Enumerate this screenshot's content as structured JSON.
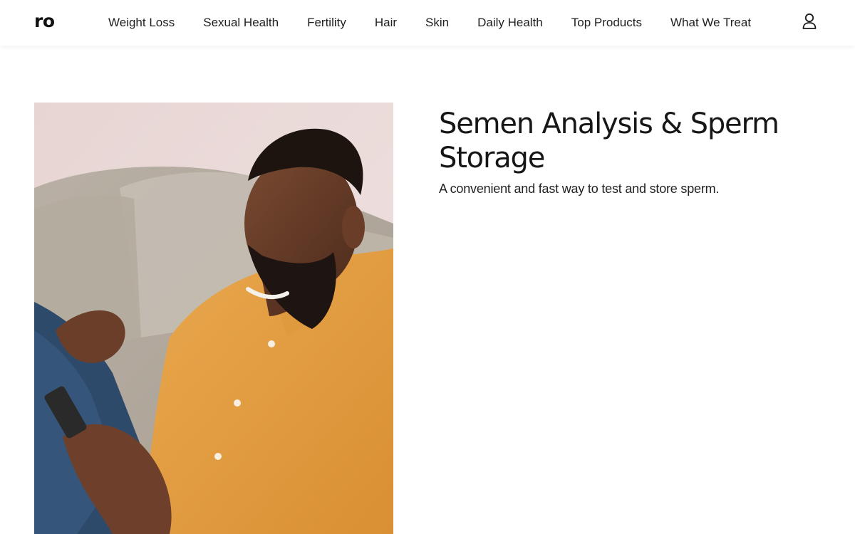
{
  "header": {
    "logo_text": "ro",
    "nav": [
      {
        "label": "Weight Loss"
      },
      {
        "label": "Sexual Health"
      },
      {
        "label": "Fertility"
      },
      {
        "label": "Hair"
      },
      {
        "label": "Skin"
      },
      {
        "label": "Daily Health"
      },
      {
        "label": "Top Products"
      },
      {
        "label": "What We Treat"
      }
    ],
    "account_icon": "person-icon"
  },
  "hero": {
    "image": "man-smiling-at-phone-on-couch",
    "title": "Semen Analysis & Sperm Storage",
    "subtitle": "A convenient and fast way to test and store sperm."
  },
  "colors": {
    "text": "#161616",
    "shirt": "#e6a047",
    "background": "#ffffff"
  }
}
